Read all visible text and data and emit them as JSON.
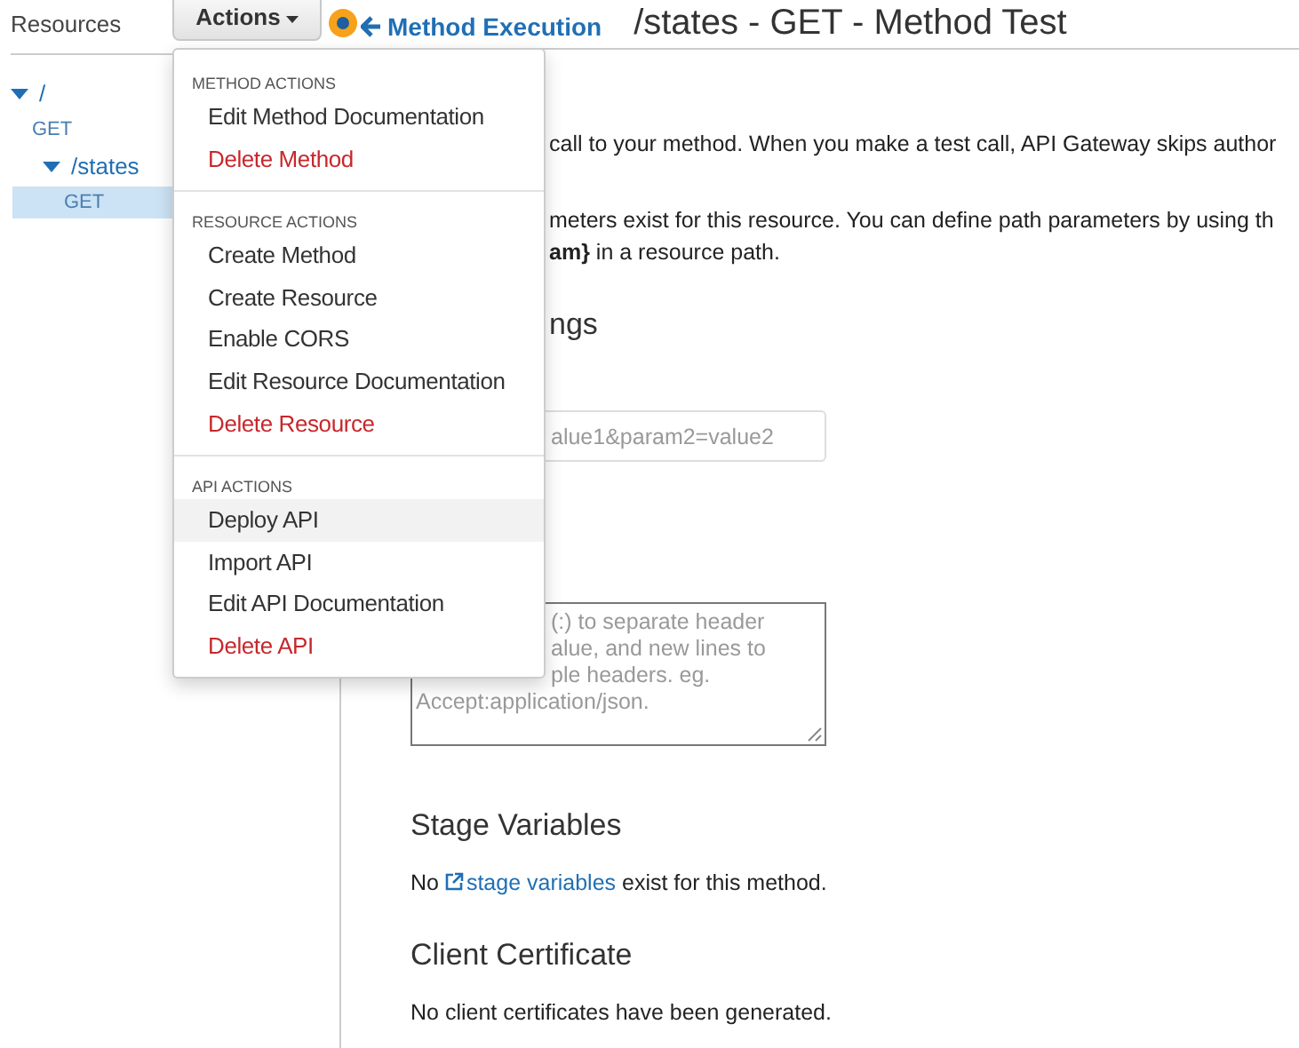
{
  "sidebar": {
    "title": "Resources",
    "tree": [
      {
        "label": "/",
        "expanded": true,
        "children": [
          {
            "label": "GET",
            "selected": false
          },
          {
            "label": "/states",
            "expanded": true,
            "children": [
              {
                "label": "GET",
                "selected": true
              }
            ]
          }
        ]
      }
    ]
  },
  "actions_button": {
    "label": "Actions"
  },
  "back_link": "Method Execution",
  "page_title": "/states - GET - Method Test",
  "intro_text": "call to your method. When you make a test call, API Gateway skips author",
  "path_text": [
    "meters exist for this resource. You can define path parameters by using th",
    "**am}** in a resource path."
  ],
  "query_heading": "ngs",
  "query_field": {
    "placeholder": "alue1&param2=value2"
  },
  "headers_field": {
    "placeholder_lines": [
      "(:) to separate header",
      "alue, and new lines to",
      "ple headers. eg.",
      "Accept:application/json."
    ]
  },
  "stage_variables": {
    "heading": "Stage Variables",
    "text_before": "No",
    "link": "stage variables",
    "text_after": "exist for this method."
  },
  "client_certificate": {
    "heading": "Client Certificate",
    "text": "No client certificates have been generated."
  },
  "actions_menu": {
    "sections": [
      {
        "heading": "METHOD ACTIONS",
        "items": [
          {
            "label": "Edit Method Documentation",
            "kind": "normal",
            "highlighted": false
          },
          {
            "label": "Delete Method",
            "kind": "danger",
            "highlighted": false
          }
        ]
      },
      {
        "heading": "RESOURCE ACTIONS",
        "items": [
          {
            "label": "Create Method",
            "kind": "normal",
            "highlighted": false
          },
          {
            "label": "Create Resource",
            "kind": "normal",
            "highlighted": false
          },
          {
            "label": "Enable CORS",
            "kind": "normal",
            "highlighted": false
          },
          {
            "label": "Edit Resource Documentation",
            "kind": "normal",
            "highlighted": false
          },
          {
            "label": "Delete Resource",
            "kind": "danger",
            "highlighted": false
          }
        ]
      },
      {
        "heading": "API ACTIONS",
        "items": [
          {
            "label": "Deploy API",
            "kind": "normal",
            "highlighted": true
          },
          {
            "label": "Import API",
            "kind": "normal",
            "highlighted": false
          },
          {
            "label": "Edit API Documentation",
            "kind": "normal",
            "highlighted": false
          },
          {
            "label": "Delete API",
            "kind": "danger",
            "highlighted": false
          }
        ]
      }
    ]
  }
}
